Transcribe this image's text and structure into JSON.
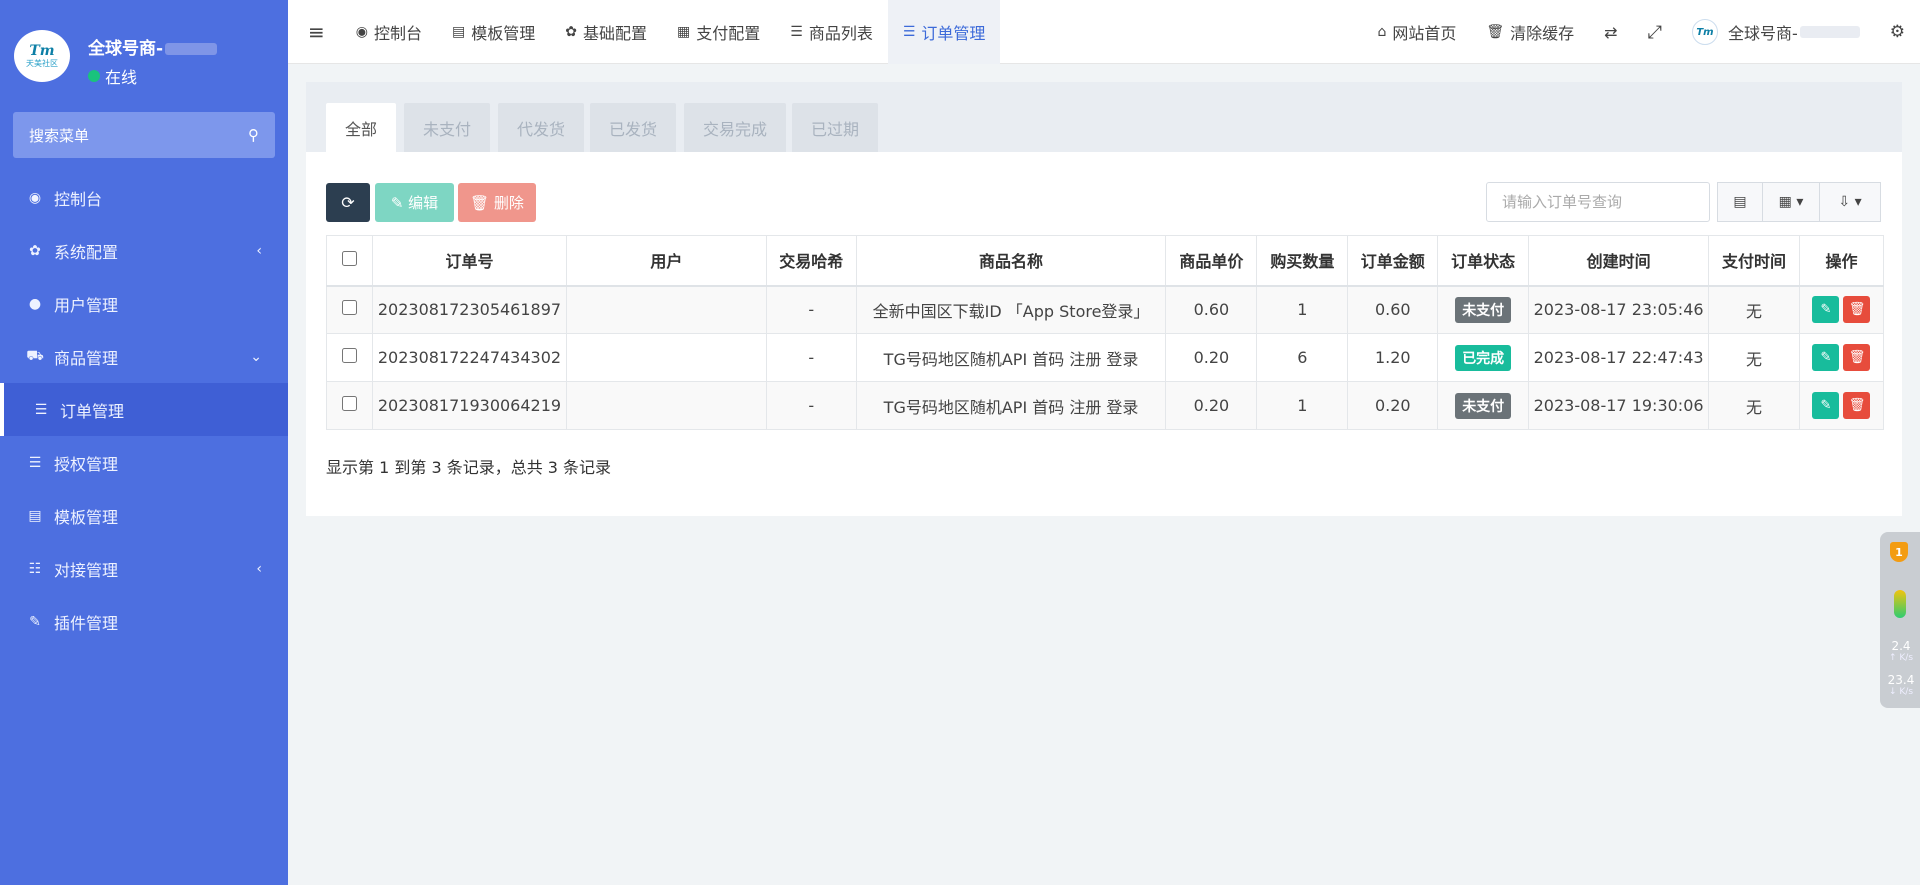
{
  "sidebar": {
    "brand_logo_text": "Tm",
    "brand_logo_sub": "天美社区",
    "brand_name": "全球号商-",
    "status": "在线",
    "search_placeholder": "搜索菜单",
    "items": [
      {
        "label": "控制台",
        "icon": "dashboard-icon",
        "glyph": "◉"
      },
      {
        "label": "系统配置",
        "icon": "gear-icon",
        "glyph": "✿",
        "arrow": "‹"
      },
      {
        "label": "用户管理",
        "icon": "user-icon",
        "glyph": "●"
      },
      {
        "label": "商品管理",
        "icon": "cart-icon",
        "glyph": "⛟",
        "arrow": "⌄"
      },
      {
        "label": "订单管理",
        "icon": "list-icon",
        "glyph": "☰"
      },
      {
        "label": "授权管理",
        "icon": "list-icon",
        "glyph": "☰"
      },
      {
        "label": "模板管理",
        "icon": "template-icon",
        "glyph": "▤"
      },
      {
        "label": "对接管理",
        "icon": "sliders-icon",
        "glyph": "☷",
        "arrow": "‹"
      },
      {
        "label": "插件管理",
        "icon": "plug-icon",
        "glyph": "✎"
      }
    ]
  },
  "topbar": {
    "menu_toggle": "≡",
    "items": [
      {
        "label": "控制台",
        "glyph": "◉"
      },
      {
        "label": "模板管理",
        "glyph": "▤"
      },
      {
        "label": "基础配置",
        "glyph": "✿"
      },
      {
        "label": "支付配置",
        "glyph": "▦"
      },
      {
        "label": "商品列表",
        "glyph": "☰"
      },
      {
        "label": "订单管理",
        "glyph": "☰"
      }
    ],
    "home_label": "网站首页",
    "clear_cache_label": "清除缓存",
    "user_name": "全球号商-"
  },
  "tabs": [
    "全部",
    "未支付",
    "代发货",
    "已发货",
    "交易完成",
    "已过期"
  ],
  "toolbar": {
    "refresh_glyph": "⟳",
    "edit_label": "✎ 编辑",
    "delete_label": "🗑 删除",
    "search_placeholder": "请输入订单号查询"
  },
  "table": {
    "headers": [
      "订单号",
      "用户",
      "交易哈希",
      "商品名称",
      "商品单价",
      "购买数量",
      "订单金额",
      "订单状态",
      "创建时间",
      "支付时间",
      "操作"
    ],
    "rows": [
      {
        "order_no": "202308172305461897",
        "user": "",
        "hash": "-",
        "product": "全新中国区下载ID 「App Store登录」",
        "price": "0.60",
        "qty": "1",
        "amount": "0.60",
        "status": "未支付",
        "status_type": "unpaid",
        "created": "2023-08-17 23:05:46",
        "paid": "无"
      },
      {
        "order_no": "202308172247434302",
        "user": "",
        "hash": "-",
        "product": "TG号码地区随机API 首码 注册 登录",
        "price": "0.20",
        "qty": "6",
        "amount": "1.20",
        "status": "已完成",
        "status_type": "done",
        "created": "2023-08-17 22:47:43",
        "paid": "无"
      },
      {
        "order_no": "202308171930064219",
        "user": "",
        "hash": "-",
        "product": "TG号码地区随机API 首码 注册 登录",
        "price": "0.20",
        "qty": "1",
        "amount": "0.20",
        "status": "未支付",
        "status_type": "unpaid",
        "created": "2023-08-17 19:30:06",
        "paid": "无"
      }
    ]
  },
  "summary": "显示第 1 到第 3 条记录，总共 3 条记录",
  "widget": {
    "badge": "1",
    "upload": "2.4",
    "upload_unit": "↑ K/s",
    "download": "23.4",
    "download_unit": "↓ K/s"
  },
  "colors": {
    "sidebar": "#4d6fe0",
    "active_tab": "#3c6ad9",
    "success": "#18bc9c",
    "danger": "#e74c3c"
  }
}
